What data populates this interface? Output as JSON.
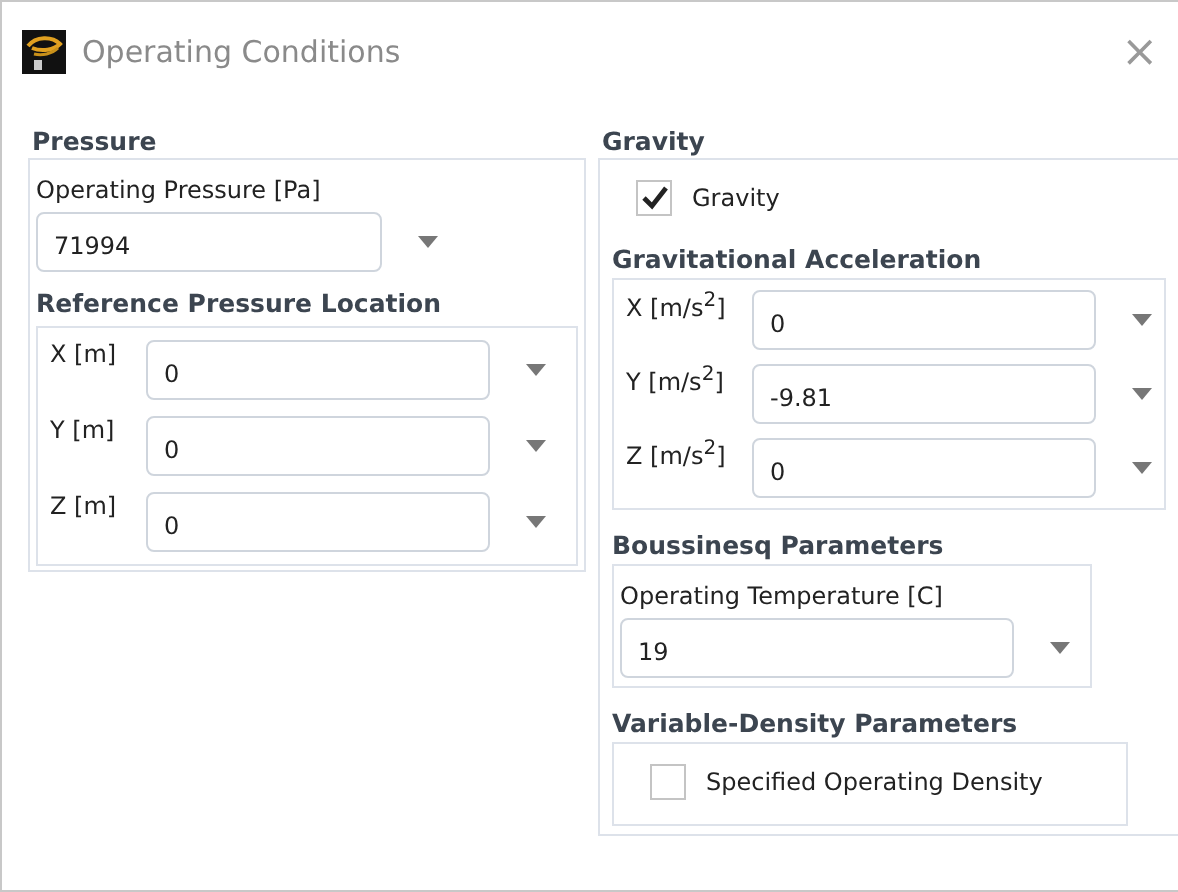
{
  "window": {
    "title": "Operating Conditions",
    "close": "×"
  },
  "pressure": {
    "heading": "Pressure",
    "operating_label": "Operating Pressure [Pa]",
    "operating_value": "71994",
    "location_heading": "Reference Pressure Location",
    "location": [
      {
        "label": "X [m]",
        "value": "0"
      },
      {
        "label": "Y [m]",
        "value": "0"
      },
      {
        "label": "Z [m]",
        "value": "0"
      }
    ]
  },
  "gravity": {
    "heading": "Gravity",
    "checkbox": {
      "label": "Gravity",
      "checked": true
    },
    "acceleration_heading": "Gravitational Acceleration",
    "acceleration": [
      {
        "label": "X [m/s$^{2}$]",
        "value": "0"
      },
      {
        "label": "Y [m/s$^{2}$]",
        "value": "-9.81"
      },
      {
        "label": "Z [m/s$^{2}$]",
        "value": "0"
      }
    ]
  },
  "boussinesq": {
    "heading": "Boussinesq Parameters",
    "label": "Operating Temperature [C]",
    "value": "19"
  },
  "variable_density": {
    "heading": "Variable-Density Parameters",
    "checkbox": {
      "label": "Specified Operating Density",
      "checked": false
    }
  }
}
